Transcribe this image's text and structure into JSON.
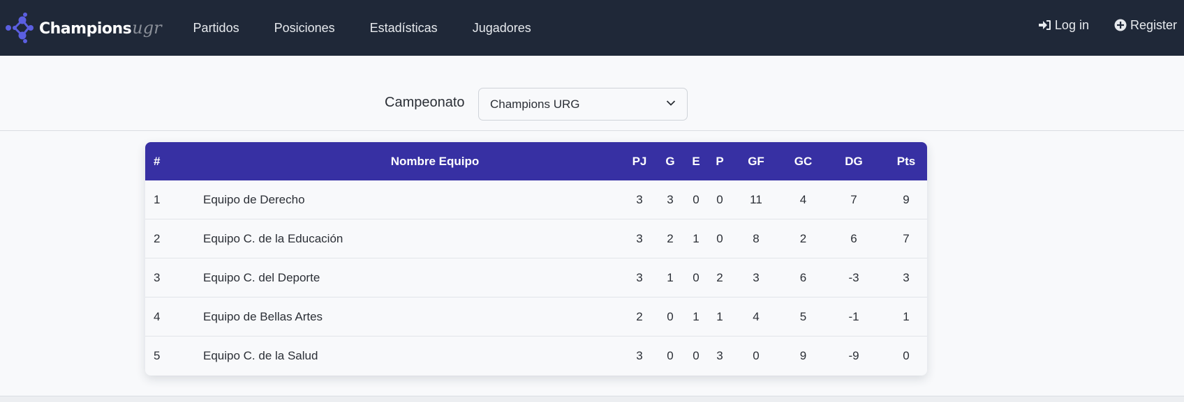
{
  "navbar": {
    "brand_main": "Champions",
    "brand_sub": "ugr",
    "links": [
      "Partidos",
      "Posiciones",
      "Estadísticas",
      "Jugadores"
    ],
    "login": "Log in",
    "register": "Register"
  },
  "selector": {
    "label": "Campeonato",
    "value": "Champions URG"
  },
  "table": {
    "headers": {
      "rank": "#",
      "name": "Nombre Equipo",
      "pj": "PJ",
      "g": "G",
      "e": "E",
      "p": "P",
      "gf": "GF",
      "gc": "GC",
      "dg": "DG",
      "pts": "Pts"
    },
    "rows": [
      {
        "rank": "1",
        "name": "Equipo de Derecho",
        "pj": "3",
        "g": "3",
        "e": "0",
        "p": "0",
        "gf": "11",
        "gc": "4",
        "dg": "7",
        "pts": "9"
      },
      {
        "rank": "2",
        "name": "Equipo C. de la Educación",
        "pj": "3",
        "g": "2",
        "e": "1",
        "p": "0",
        "gf": "8",
        "gc": "2",
        "dg": "6",
        "pts": "7"
      },
      {
        "rank": "3",
        "name": "Equipo C. del Deporte",
        "pj": "3",
        "g": "1",
        "e": "0",
        "p": "2",
        "gf": "3",
        "gc": "6",
        "dg": "-3",
        "pts": "3"
      },
      {
        "rank": "4",
        "name": "Equipo de Bellas Artes",
        "pj": "2",
        "g": "0",
        "e": "1",
        "p": "1",
        "gf": "4",
        "gc": "5",
        "dg": "-1",
        "pts": "1"
      },
      {
        "rank": "5",
        "name": "Equipo C. de la Salud",
        "pj": "3",
        "g": "0",
        "e": "0",
        "p": "3",
        "gf": "0",
        "gc": "9",
        "dg": "-9",
        "pts": "0"
      }
    ]
  },
  "colors": {
    "navbar_bg": "#1f2838",
    "table_header_bg": "#3730a3",
    "brand_accent": "#5b5fe0"
  },
  "icons": {
    "brand": "molecule-logo-icon",
    "login": "sign-in-icon",
    "register": "plus-circle-icon",
    "select": "chevron-down-icon"
  }
}
